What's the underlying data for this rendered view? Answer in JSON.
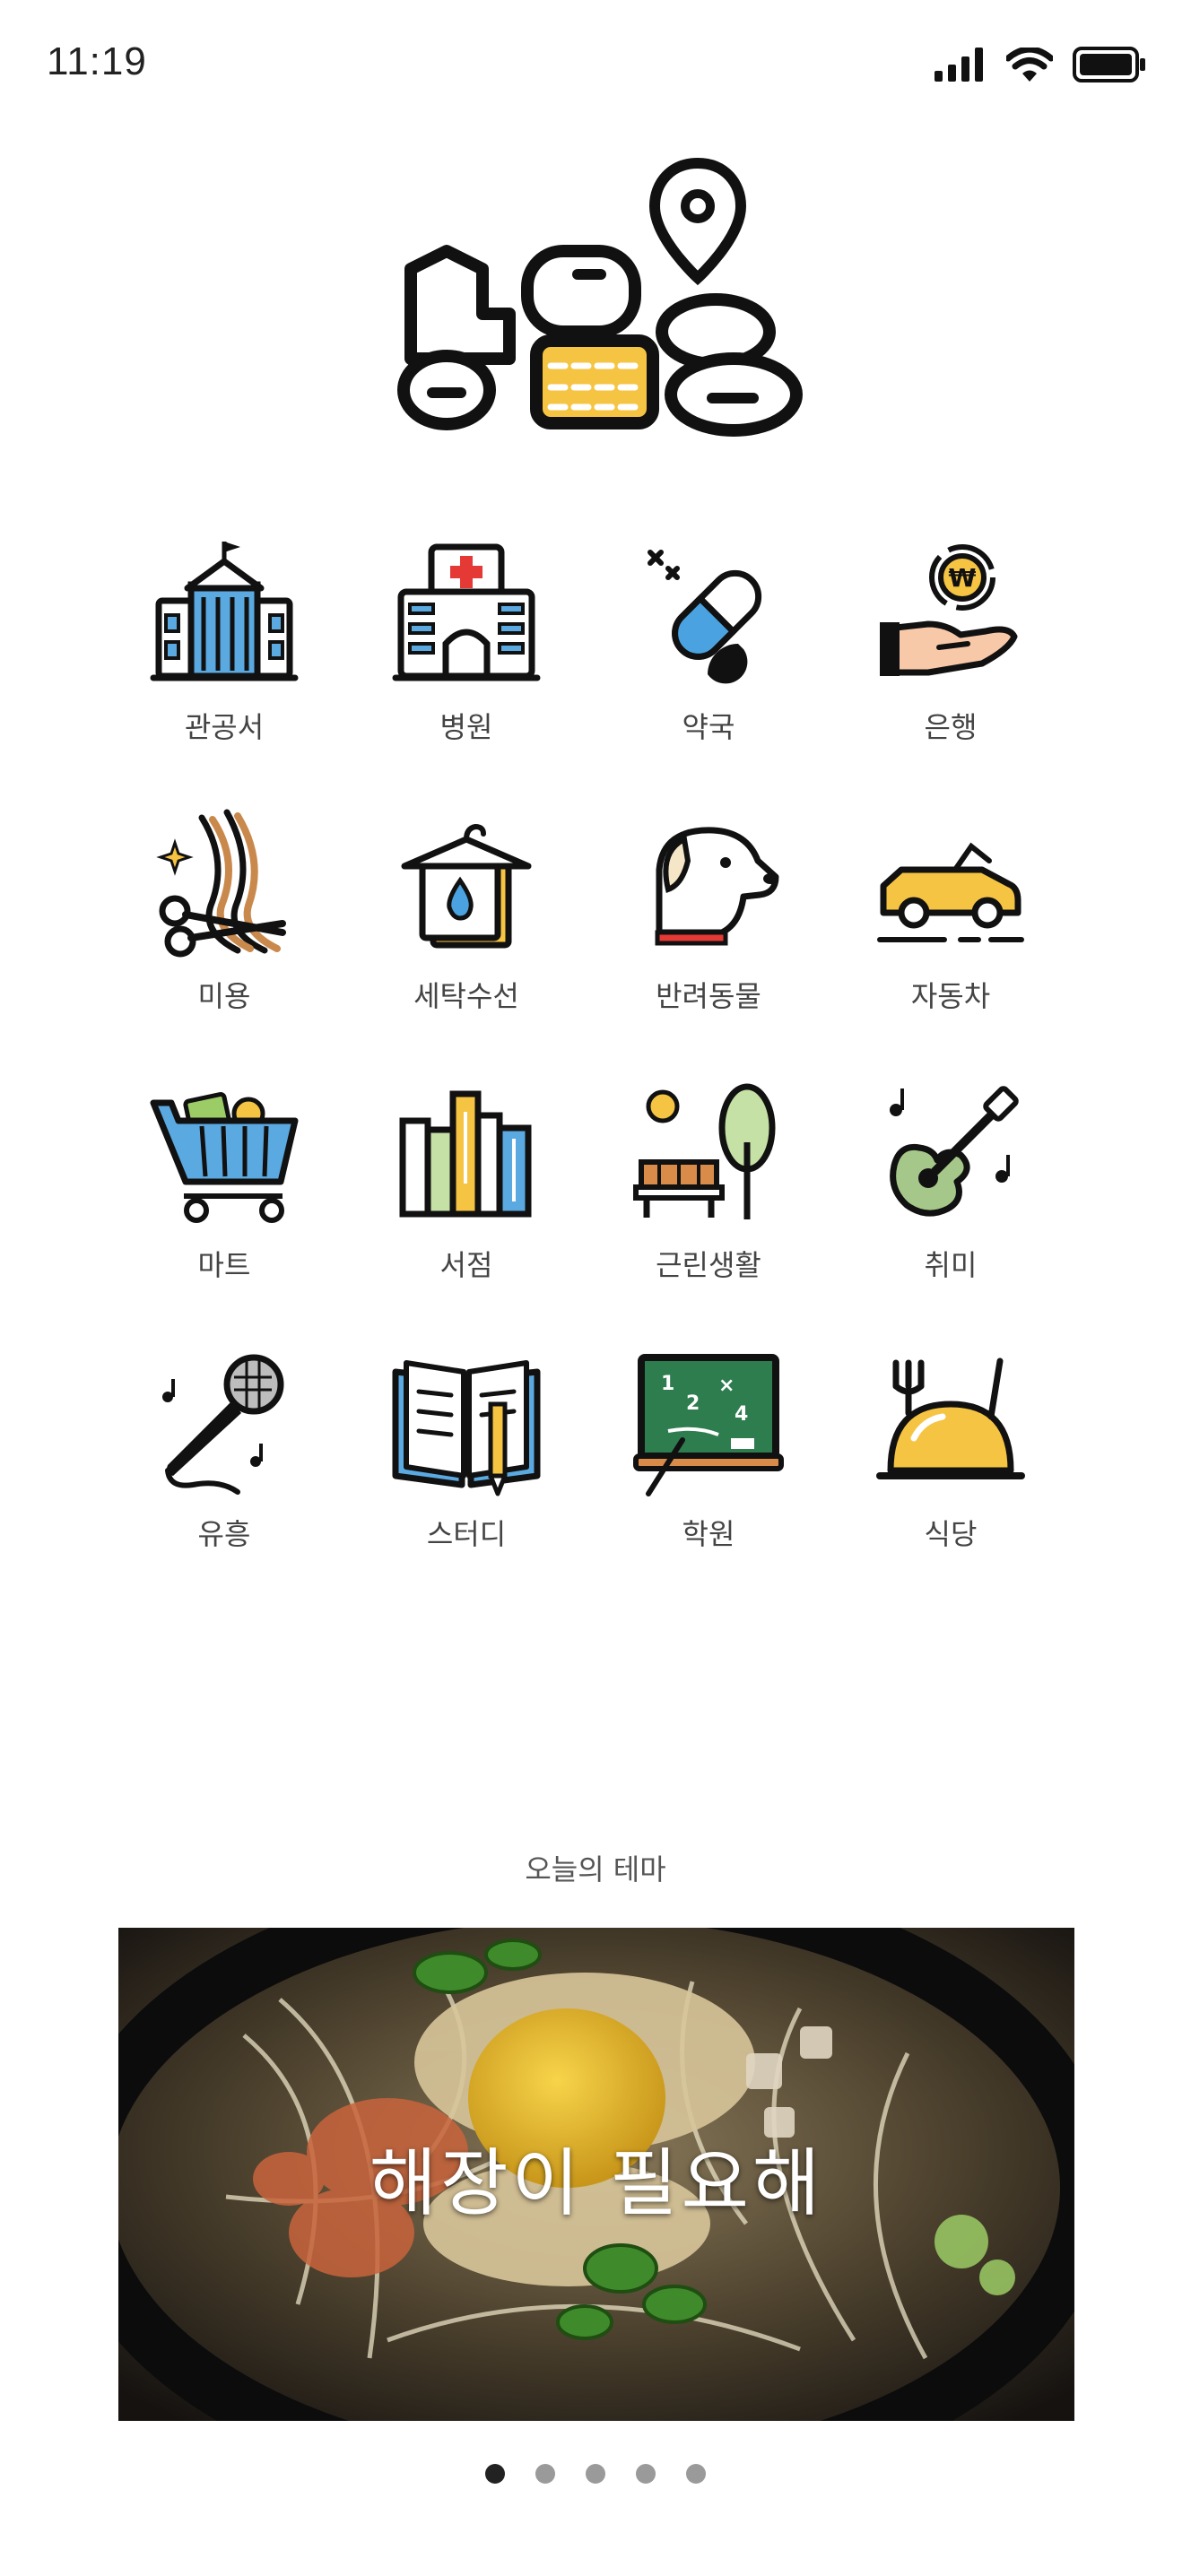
{
  "status_bar": {
    "time": "11:19"
  },
  "logo": {
    "text": "상일동",
    "accent": "#f6c443"
  },
  "categories": [
    {
      "label": "관공서",
      "icon": "government-building-icon"
    },
    {
      "label": "병원",
      "icon": "hospital-icon"
    },
    {
      "label": "약국",
      "icon": "pill-icon"
    },
    {
      "label": "은행",
      "icon": "coin-hand-icon"
    },
    {
      "label": "미용",
      "icon": "scissors-hair-icon"
    },
    {
      "label": "세탁수선",
      "icon": "laundry-hanger-icon"
    },
    {
      "label": "반려동물",
      "icon": "dog-icon"
    },
    {
      "label": "자동차",
      "icon": "car-icon"
    },
    {
      "label": "마트",
      "icon": "shopping-cart-icon"
    },
    {
      "label": "서점",
      "icon": "books-icon"
    },
    {
      "label": "근린생활",
      "icon": "park-bench-tree-icon"
    },
    {
      "label": "취미",
      "icon": "guitar-icon"
    },
    {
      "label": "유흥",
      "icon": "microphone-icon"
    },
    {
      "label": "스터디",
      "icon": "open-book-pencil-icon"
    },
    {
      "label": "학원",
      "icon": "chalkboard-icon"
    },
    {
      "label": "식당",
      "icon": "cloche-dish-icon"
    }
  ],
  "theme": {
    "section_title": "오늘의 테마",
    "banner_text": "해장이 필요해",
    "slides_total": 5,
    "active_slide": 1
  }
}
